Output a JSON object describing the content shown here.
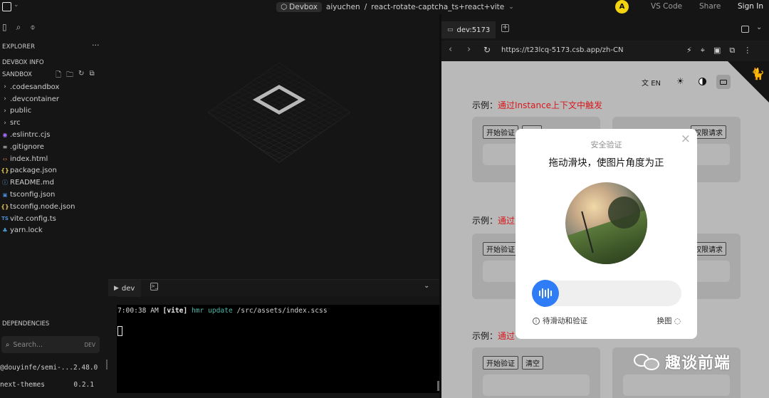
{
  "topbar": {
    "project_pill": "Devbox",
    "owner": "aiyuchen",
    "separator": "/",
    "repo": "react-rotate-captcha_ts+react+vite",
    "avatar_letter": "A",
    "vscode": "VS Code",
    "share": "Share",
    "signin": "Sign In"
  },
  "explorer": {
    "title": "EXPLORER",
    "more": "···",
    "devbox_info": "DEVBOX INFO",
    "sandbox": "SANDBOX",
    "files": [
      {
        "icon": "chevron-right",
        "name": ".codesandbox"
      },
      {
        "icon": "chevron-right",
        "name": ".devcontainer"
      },
      {
        "icon": "chevron-right",
        "name": "public"
      },
      {
        "icon": "chevron-right",
        "name": "src"
      },
      {
        "icon": "eslint",
        "name": ".eslintrc.cjs"
      },
      {
        "icon": "lines",
        "name": ".gitignore"
      },
      {
        "icon": "html",
        "name": "index.html"
      },
      {
        "icon": "json",
        "name": "package.json"
      },
      {
        "icon": "info",
        "name": "README.md"
      },
      {
        "icon": "ts-config",
        "name": "tsconfig.json"
      },
      {
        "icon": "json",
        "name": "tsconfig.node.json"
      },
      {
        "icon": "ts",
        "name": "vite.config.ts"
      },
      {
        "icon": "yarn",
        "name": "yarn.lock"
      }
    ]
  },
  "dependencies": {
    "title": "DEPENDENCIES",
    "search_placeholder": "Search...",
    "search_badge": "DEV",
    "items": [
      {
        "name": "@douyinfe/semi-...",
        "version": "2.48.0"
      },
      {
        "name": "next-themes",
        "version": "0.2.1"
      }
    ]
  },
  "terminal": {
    "tab_label": "dev",
    "time": "7:00:38 AM",
    "tag": "[vite]",
    "action": "hmr update",
    "path": "/src/assets/index.scss"
  },
  "preview": {
    "tab_label": "dev:5173",
    "url": "https://t23lcq-5173.csb.app/zh-CN",
    "lang": "EN",
    "examples": [
      {
        "prefix": "示例：",
        "title": "通过Instance上下文中触发",
        "buttons": [
          "开始验证",
          ""
        ],
        "right_button": "权限请求"
      },
      {
        "prefix": "示例：",
        "title": "通过",
        "buttons": [
          "开始验证",
          ""
        ],
        "right_button": "权限请求"
      },
      {
        "prefix": "示例：",
        "title": "通过",
        "buttons": [
          "开始验证",
          "清空"
        ],
        "right_button": ""
      }
    ]
  },
  "captcha": {
    "title": "安全验证",
    "instruction": "拖动滑块，使图片角度为正",
    "status": "待滑动和验证",
    "refresh": "换图",
    "accent": "#2e7cf6"
  },
  "watermark": {
    "text": "趣谈前端"
  }
}
